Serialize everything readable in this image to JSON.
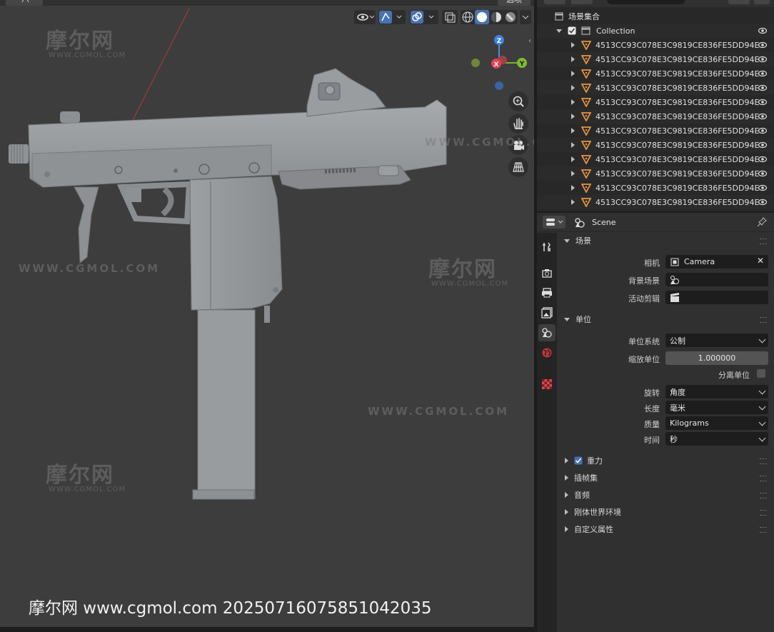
{
  "viewport": {
    "header_menu_text": "八",
    "options_label": "选项",
    "axes": {
      "z": "Z",
      "x": "X",
      "y": "Y"
    },
    "nav_icons": [
      "zoom-icon",
      "hand-pan-icon",
      "camera-view-icon",
      "perspective-grid-icon"
    ],
    "watermarks": {
      "logo": "摩尔网",
      "logo_sub": "WWW.CGMOL.COM",
      "url": "WWW.CGMOL.COM"
    },
    "footer_watermark": "摩尔网 www.cgmol.com 20250716075851042035"
  },
  "outliner": {
    "scene_collection": "场景集合",
    "collection": "Collection",
    "object_name": "4513CC93C078E3C9819CE836FE5DD94E",
    "object_count": 12
  },
  "properties": {
    "header_title": "Scene",
    "panels": {
      "scene": {
        "title": "场景",
        "camera_label": "相机",
        "camera_value": "Camera",
        "background_label": "背景场景",
        "active_clip_label": "活动剪辑"
      },
      "units": {
        "title": "单位",
        "unit_system_label": "单位系统",
        "unit_system_value": "公制",
        "unit_scale_label": "缩放单位",
        "unit_scale_value": "1.000000",
        "separate_units_label": "分离单位",
        "rotation_label": "旋转",
        "rotation_value": "角度",
        "length_label": "长度",
        "length_value": "毫米",
        "mass_label": "质量",
        "mass_value": "Kilograms",
        "time_label": "时间",
        "time_value": "秒"
      },
      "collapsed": {
        "gravity": "重力",
        "keying_sets": "插帧集",
        "audio": "音频",
        "rigid_body_world": "刚体世界环境",
        "custom_props": "自定义属性"
      }
    }
  }
}
